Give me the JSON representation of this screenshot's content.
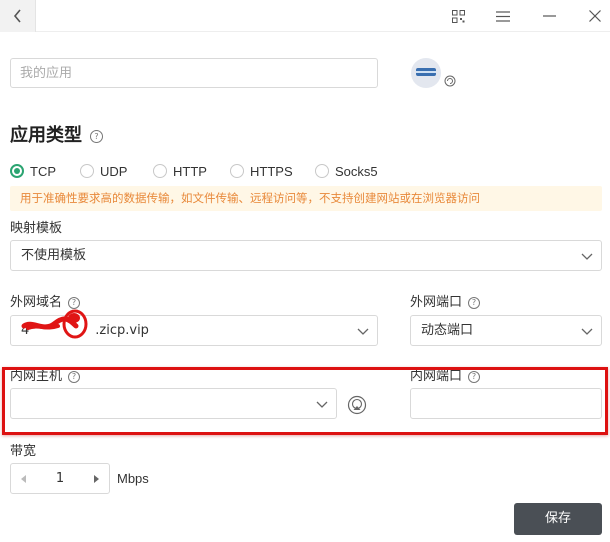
{
  "icons": {
    "back": "chevron-left-icon",
    "qr": "qr-code-icon",
    "menu": "hamburger-menu-icon",
    "minimize": "minimize-icon",
    "close": "close-icon",
    "app": "app-avatar-icon",
    "help": "question-circle-icon",
    "dropdown": "chevron-down-icon",
    "airplay": "airplay-icon"
  },
  "colors": {
    "accent": "#2ba471",
    "hint_bg": "#fff7e6",
    "hint_text": "#e8893a",
    "annotation": "#dd1111",
    "save_bg": "#4a4f55"
  },
  "app_name": {
    "placeholder": "我的应用",
    "value": ""
  },
  "app_type": {
    "title": "应用类型",
    "help_glyph": "?",
    "options": [
      "TCP",
      "UDP",
      "HTTP",
      "HTTPS",
      "Socks5"
    ],
    "selected": "TCP",
    "hint": "用于准确性要求高的数据传输，如文件传输、远程访问等，不支持创建网站或在浏览器访问"
  },
  "template": {
    "label": "映射模板",
    "value": "不使用模板"
  },
  "external_domain": {
    "label": "外网域名",
    "value_prefix": "4",
    "value_suffix": ".zicp.vip"
  },
  "external_port": {
    "label": "外网端口",
    "value": "动态端口"
  },
  "internal_host": {
    "label": "内网主机",
    "value": ""
  },
  "internal_port": {
    "label": "内网端口",
    "value": ""
  },
  "bandwidth": {
    "label": "带宽",
    "value": "1",
    "unit": "Mbps"
  },
  "save_label": "保存"
}
